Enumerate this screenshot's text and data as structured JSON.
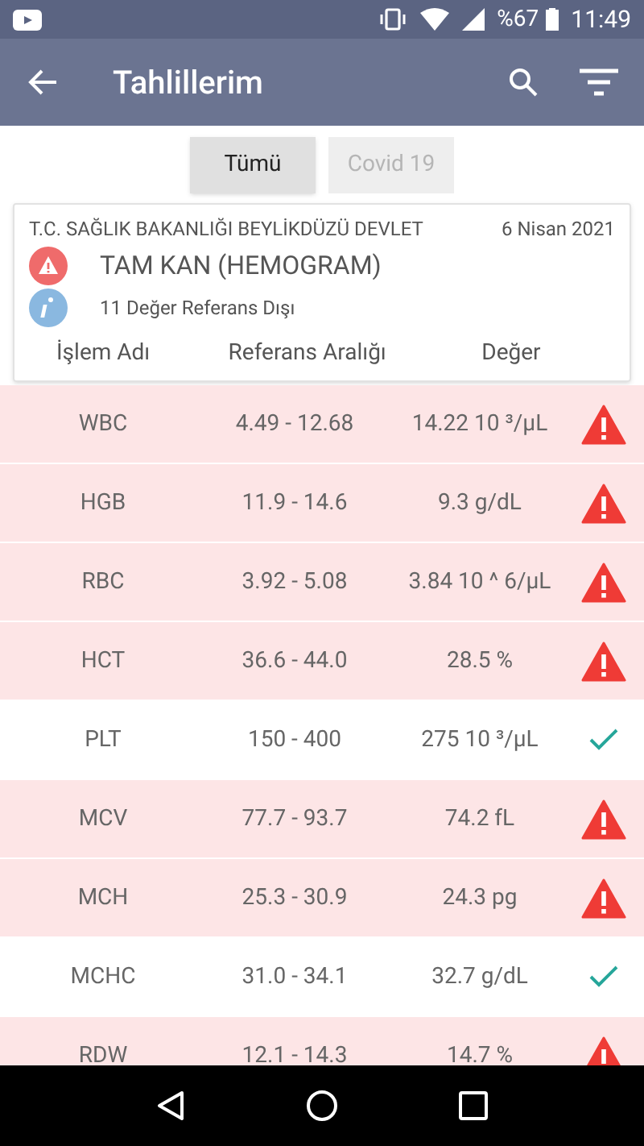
{
  "status_bar": {
    "battery": "%67",
    "time": "11:49"
  },
  "app_bar": {
    "title": "Tahlillerim"
  },
  "tabs": [
    {
      "label": "Tümü",
      "selected": true
    },
    {
      "label": "Covid 19",
      "selected": false
    }
  ],
  "card": {
    "institution": "T.C. SAĞLIK BAKANLIĞI BEYLİKDÜZÜ DEVLET",
    "date": "6 Nisan 2021",
    "test_name": "TAM KAN (HEMOGRAM)",
    "summary": "11 Değer Referans Dışı",
    "columns": [
      "İşlem Adı",
      "Referans Aralığı",
      "Değer"
    ]
  },
  "rows": [
    {
      "name": "WBC",
      "range": "4.49 - 12.68",
      "value": "14.22 10 ³/µL",
      "abnormal": true
    },
    {
      "name": "HGB",
      "range": "11.9 - 14.6",
      "value": "9.3 g/dL",
      "abnormal": true
    },
    {
      "name": "RBC",
      "range": "3.92 - 5.08",
      "value": "3.84 10 ^ 6/µL",
      "abnormal": true
    },
    {
      "name": "HCT",
      "range": "36.6 - 44.0",
      "value": "28.5 %",
      "abnormal": true
    },
    {
      "name": "PLT",
      "range": "150 - 400",
      "value": "275 10 ³/µL",
      "abnormal": false
    },
    {
      "name": "MCV",
      "range": "77.7 - 93.7",
      "value": "74.2 fL",
      "abnormal": true
    },
    {
      "name": "MCH",
      "range": "25.3 - 30.9",
      "value": "24.3 pg",
      "abnormal": true
    },
    {
      "name": "MCHC",
      "range": "31.0 - 34.1",
      "value": "32.7 g/dL",
      "abnormal": false
    },
    {
      "name": "RDW",
      "range": "12.1 - 14.3",
      "value": "14.7 %",
      "abnormal": true
    }
  ]
}
